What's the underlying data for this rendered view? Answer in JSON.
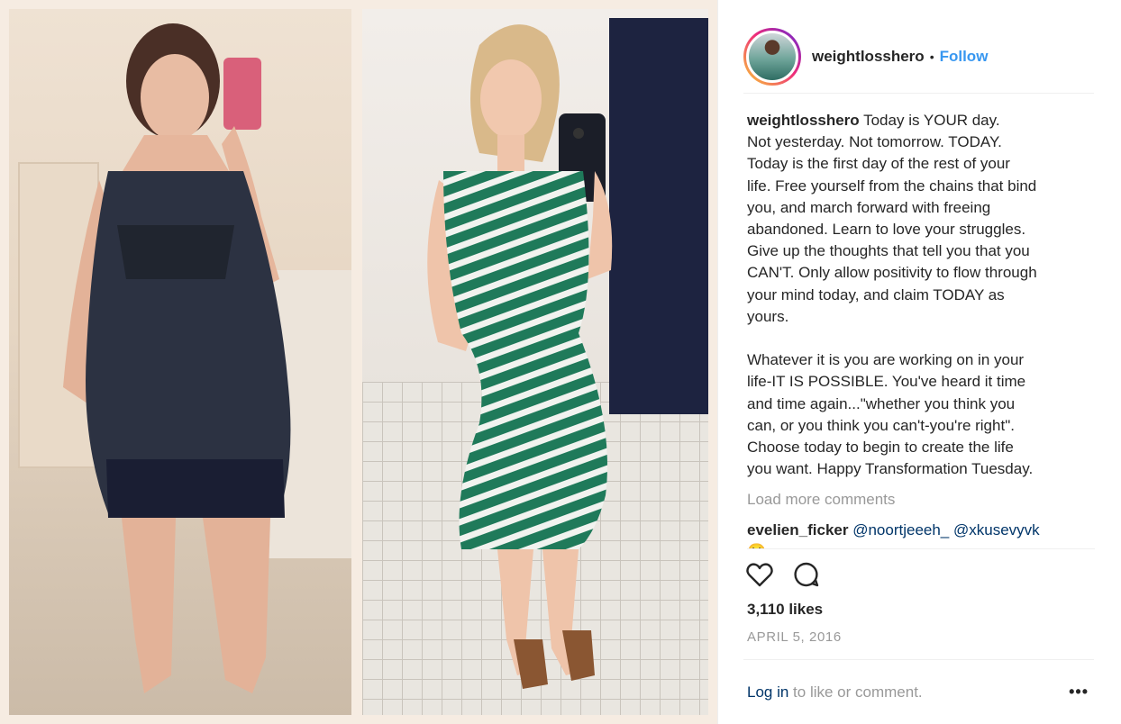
{
  "post": {
    "username": "weightlosshero",
    "separator": "•",
    "follow_label": "Follow",
    "caption_user": "weightlosshero",
    "caption_text": " Today is YOUR day.\nNot yesterday. Not tomorrow. TODAY.\nToday is the first day of the rest of your\nlife. Free yourself from the chains that bind\nyou, and march forward with freeing\nabandoned. Learn to love your struggles.\nGive up the thoughts that tell you that you\nCAN'T. Only allow positivity to flow through\nyour mind today, and claim TODAY as\nyours.\n\nWhatever it is you are working on in your\nlife-IT IS POSSIBLE. You've heard it time\nand time again...\"whether you think you\ncan, or you think you can't-you're right\".\nChoose today to begin to create the life\nyou want. Happy Transformation Tuesday.",
    "load_more_label": "Load more comments",
    "comment": {
      "user": "evelien_ficker",
      "mention1": "@noortjeeeh_",
      "mention2": "@xkusevyvk",
      "second_line": "🙄 wow"
    },
    "likes": "3,110 likes",
    "date": "APRIL 5, 2016",
    "footer": {
      "login_label": "Log in",
      "rest": " to like or comment.",
      "more_label": "•••"
    },
    "icons": {
      "like": "heart-icon",
      "comment": "comment-bubble-icon",
      "more": "more-options-icon"
    }
  },
  "colors": {
    "accent": "#3897f0",
    "link": "#003569",
    "muted": "#999999",
    "dress_green": "#1f7a5a"
  }
}
